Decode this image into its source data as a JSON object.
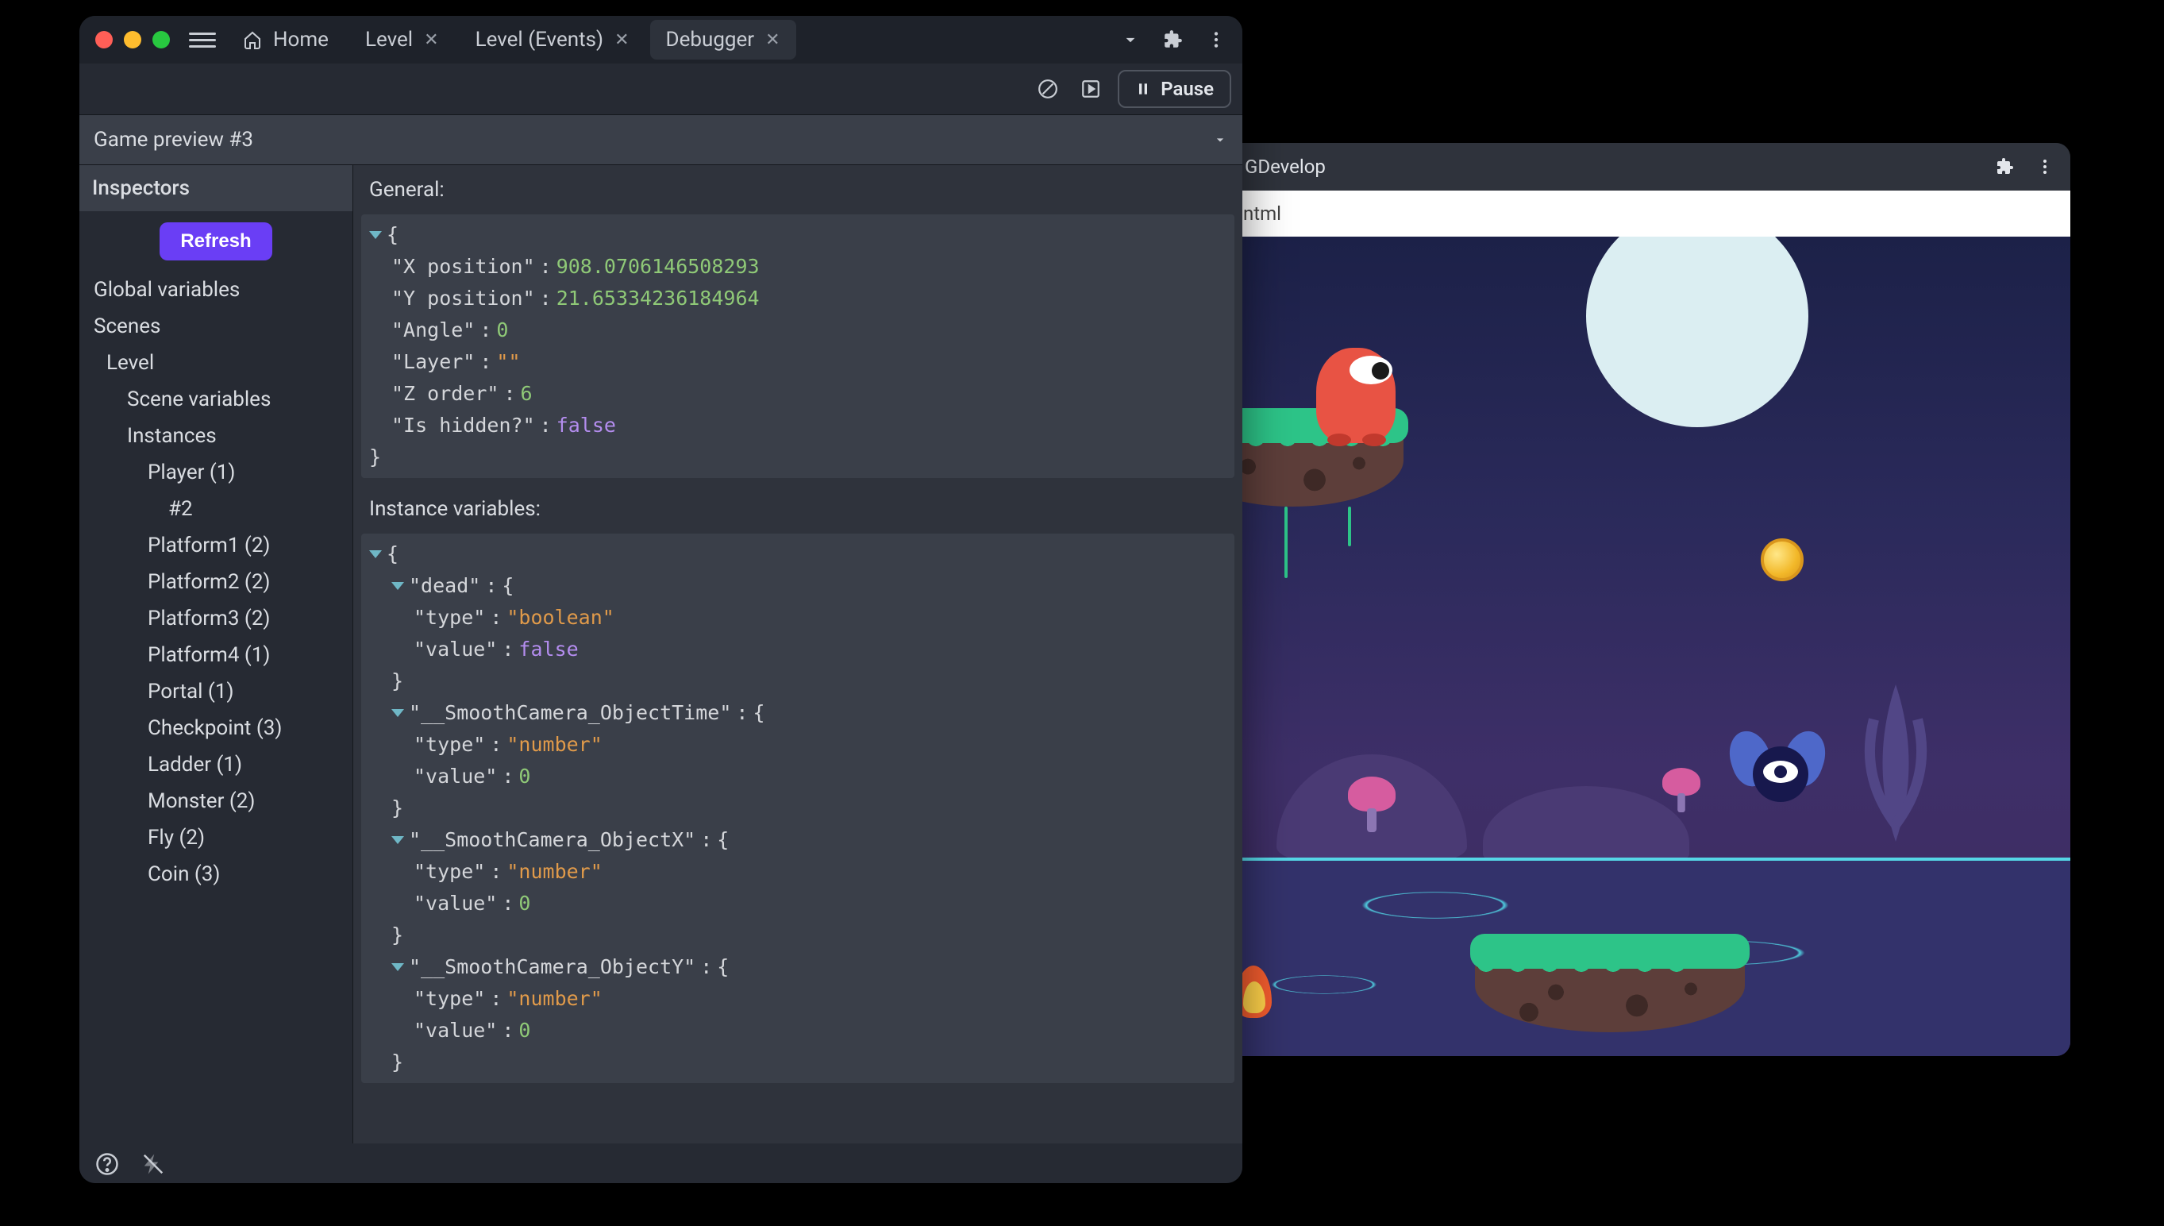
{
  "tabs": {
    "home": "Home",
    "level": "Level",
    "level_events": "Level (Events)",
    "debugger": "Debugger"
  },
  "toolbar": {
    "pause": "Pause"
  },
  "sub_header": {
    "title": "Game preview #3"
  },
  "inspectors": {
    "title": "Inspectors",
    "refresh": "Refresh",
    "tree": {
      "global_variables": "Global variables",
      "scenes": "Scenes",
      "level": "Level",
      "scene_variables": "Scene variables",
      "instances": "Instances",
      "items": [
        "Player (1)",
        "#2",
        "Platform1 (2)",
        "Platform2 (2)",
        "Platform3 (2)",
        "Platform4 (1)",
        "Portal (1)",
        "Checkpoint (3)",
        "Ladder (1)",
        "Monster (2)",
        "Fly (2)",
        "Coin (3)"
      ]
    }
  },
  "main": {
    "general_label": "General:",
    "instance_vars_label": "Instance variables:",
    "general": {
      "x_position_key": "\"X position\"",
      "x_position_val": "908.0706146508293",
      "y_position_key": "\"Y position\"",
      "y_position_val": "21.65334236184964",
      "angle_key": "\"Angle\"",
      "angle_val": "0",
      "layer_key": "\"Layer\"",
      "layer_val": "\"\"",
      "z_key": "\"Z order\"",
      "z_val": "6",
      "hidden_key": "\"Is hidden?\"",
      "hidden_val": "false"
    },
    "instance_vars": [
      {
        "name": "\"dead\"",
        "type_key": "\"type\"",
        "type_val": "\"boolean\"",
        "value_key": "\"value\"",
        "value_val": "false",
        "value_class": "bool"
      },
      {
        "name": "\"__SmoothCamera_ObjectTime\"",
        "type_key": "\"type\"",
        "type_val": "\"number\"",
        "value_key": "\"value\"",
        "value_val": "0",
        "value_class": "num"
      },
      {
        "name": "\"__SmoothCamera_ObjectX\"",
        "type_key": "\"type\"",
        "type_val": "\"number\"",
        "value_key": "\"value\"",
        "value_val": "0",
        "value_class": "num"
      },
      {
        "name": "\"__SmoothCamera_ObjectY\"",
        "type_key": "\"type\"",
        "type_val": "\"number\"",
        "value_key": "\"value\"",
        "value_val": "0",
        "value_class": "num"
      }
    ]
  },
  "game_window": {
    "title": "GDevelop",
    "url": "ntml"
  }
}
